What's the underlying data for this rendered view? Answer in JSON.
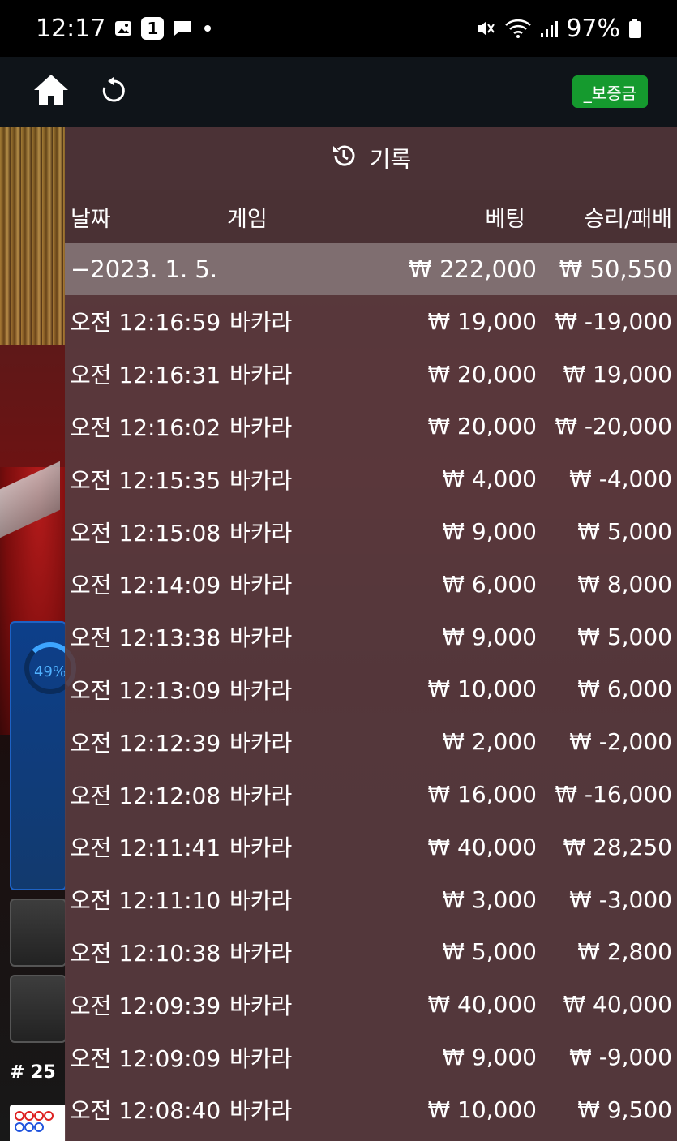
{
  "status_bar": {
    "time": "12:17",
    "notification_badge": "1",
    "battery": "97%"
  },
  "header": {
    "deposit_label": "_보증금"
  },
  "game": {
    "progress_label": "49%",
    "round_label": "# 25"
  },
  "history": {
    "title": "기록",
    "columns": {
      "date": "날짜",
      "game": "게임",
      "bet": "베팅",
      "win_loss": "승리/패배"
    },
    "date_group": {
      "label": "−2023. 1. 5.",
      "total_bet": "₩ 222,000",
      "total_win": "₩ 50,550"
    },
    "rows": [
      {
        "time": "오전 12:16:59",
        "game": "바카라",
        "bet": "₩ 19,000",
        "win": "₩ -19,000"
      },
      {
        "time": "오전 12:16:31",
        "game": "바카라",
        "bet": "₩ 20,000",
        "win": "₩ 19,000"
      },
      {
        "time": "오전 12:16:02",
        "game": "바카라",
        "bet": "₩ 20,000",
        "win": "₩ -20,000"
      },
      {
        "time": "오전 12:15:35",
        "game": "바카라",
        "bet": "₩ 4,000",
        "win": "₩ -4,000"
      },
      {
        "time": "오전 12:15:08",
        "game": "바카라",
        "bet": "₩ 9,000",
        "win": "₩ 5,000"
      },
      {
        "time": "오전 12:14:09",
        "game": "바카라",
        "bet": "₩ 6,000",
        "win": "₩ 8,000"
      },
      {
        "time": "오전 12:13:38",
        "game": "바카라",
        "bet": "₩ 9,000",
        "win": "₩ 5,000"
      },
      {
        "time": "오전 12:13:09",
        "game": "바카라",
        "bet": "₩ 10,000",
        "win": "₩ 6,000"
      },
      {
        "time": "오전 12:12:39",
        "game": "바카라",
        "bet": "₩ 2,000",
        "win": "₩ -2,000"
      },
      {
        "time": "오전 12:12:08",
        "game": "바카라",
        "bet": "₩ 16,000",
        "win": "₩ -16,000"
      },
      {
        "time": "오전 12:11:41",
        "game": "바카라",
        "bet": "₩ 40,000",
        "win": "₩ 28,250"
      },
      {
        "time": "오전 12:11:10",
        "game": "바카라",
        "bet": "₩ 3,000",
        "win": "₩ -3,000"
      },
      {
        "time": "오전 12:10:38",
        "game": "바카라",
        "bet": "₩ 5,000",
        "win": "₩ 2,800"
      },
      {
        "time": "오전 12:09:39",
        "game": "바카라",
        "bet": "₩ 40,000",
        "win": "₩ 40,000"
      },
      {
        "time": "오전 12:09:09",
        "game": "바카라",
        "bet": "₩ 9,000",
        "win": "₩ -9,000"
      },
      {
        "time": "오전 12:08:40",
        "game": "바카라",
        "bet": "₩ 10,000",
        "win": "₩ 9,500"
      }
    ]
  }
}
